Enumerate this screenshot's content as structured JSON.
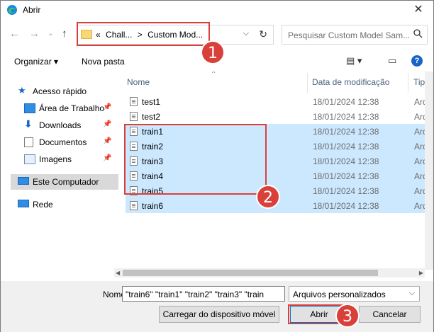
{
  "window": {
    "title": "Abrir"
  },
  "address": {
    "segments": [
      "«",
      "Chall...",
      ">",
      "Custom Mod..."
    ],
    "search_placeholder": "Pesquisar Custom Model Sam..."
  },
  "toolbar": {
    "organize": "Organizar ▾",
    "new_folder": "Nova pasta"
  },
  "sidebar": {
    "items": [
      {
        "label": "Acesso rápido"
      },
      {
        "label": "Área de Trabalho"
      },
      {
        "label": "Downloads"
      },
      {
        "label": "Documentos"
      },
      {
        "label": "Imagens"
      },
      {
        "label": "Este Computador"
      },
      {
        "label": "Rede"
      }
    ]
  },
  "columns": {
    "name": "Nome",
    "date": "Data de modificação",
    "type": "Tipo"
  },
  "files": [
    {
      "name": "test1",
      "date": "18/01/2024 12:38",
      "type": "Arqu"
    },
    {
      "name": "test2",
      "date": "18/01/2024 12:38",
      "type": "Arqu"
    },
    {
      "name": "train1",
      "date": "18/01/2024 12:38",
      "type": "Arqu"
    },
    {
      "name": "train2",
      "date": "18/01/2024 12:38",
      "type": "Arqu"
    },
    {
      "name": "train3",
      "date": "18/01/2024 12:38",
      "type": "Arqu"
    },
    {
      "name": "train4",
      "date": "18/01/2024 12:38",
      "type": "Arqu"
    },
    {
      "name": "train5",
      "date": "18/01/2024 12:38",
      "type": "Arqu"
    },
    {
      "name": "train6",
      "date": "18/01/2024 12:38",
      "type": "Arqu"
    }
  ],
  "bottom": {
    "name_label": "Nome:",
    "name_value": "\"train6\" \"train1\" \"train2\" \"train3\" \"train",
    "filter_value": "Arquivos personalizados",
    "upload_button": "Carregar do dispositivo móvel",
    "open_button": "Abrir",
    "cancel_button": "Cancelar"
  },
  "callouts": [
    "1",
    "2",
    "3"
  ],
  "colors": {
    "highlight": "#d9403a",
    "selection": "#cce8ff",
    "accent": "#1a64c8"
  }
}
